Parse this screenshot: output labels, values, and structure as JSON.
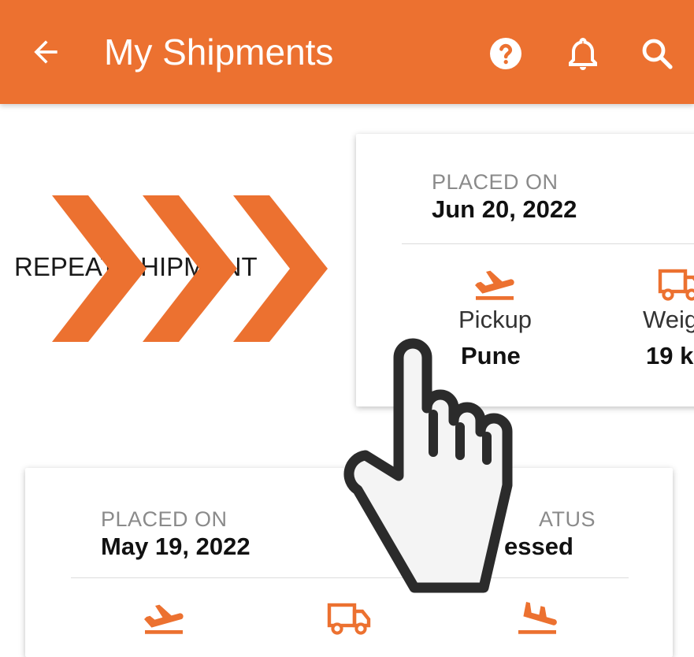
{
  "header": {
    "title": "My Shipments",
    "icons": [
      "back-arrow-icon",
      "help-icon",
      "bell-icon",
      "search-icon"
    ]
  },
  "colors": {
    "accent": "#ec7130",
    "label_gray": "#8a8a8a"
  },
  "repeat_shipment": {
    "label": "REPEAT SHIPMENT"
  },
  "cards": [
    {
      "placed_on_label": "PLACED ON",
      "placed_on_value": "Jun 20, 2022",
      "details": [
        {
          "icon": "plane-takeoff-icon",
          "label": "Pickup",
          "value": "Pune"
        },
        {
          "icon": "truck-icon",
          "label": "Weig",
          "value": "19 k"
        }
      ]
    },
    {
      "placed_on_label": "PLACED ON",
      "placed_on_value": "May 19, 2022",
      "status_label": "ATUS",
      "status_value": "essed",
      "detail_icons": [
        "plane-takeoff-icon",
        "truck-icon",
        "plane-landing-icon"
      ]
    }
  ]
}
